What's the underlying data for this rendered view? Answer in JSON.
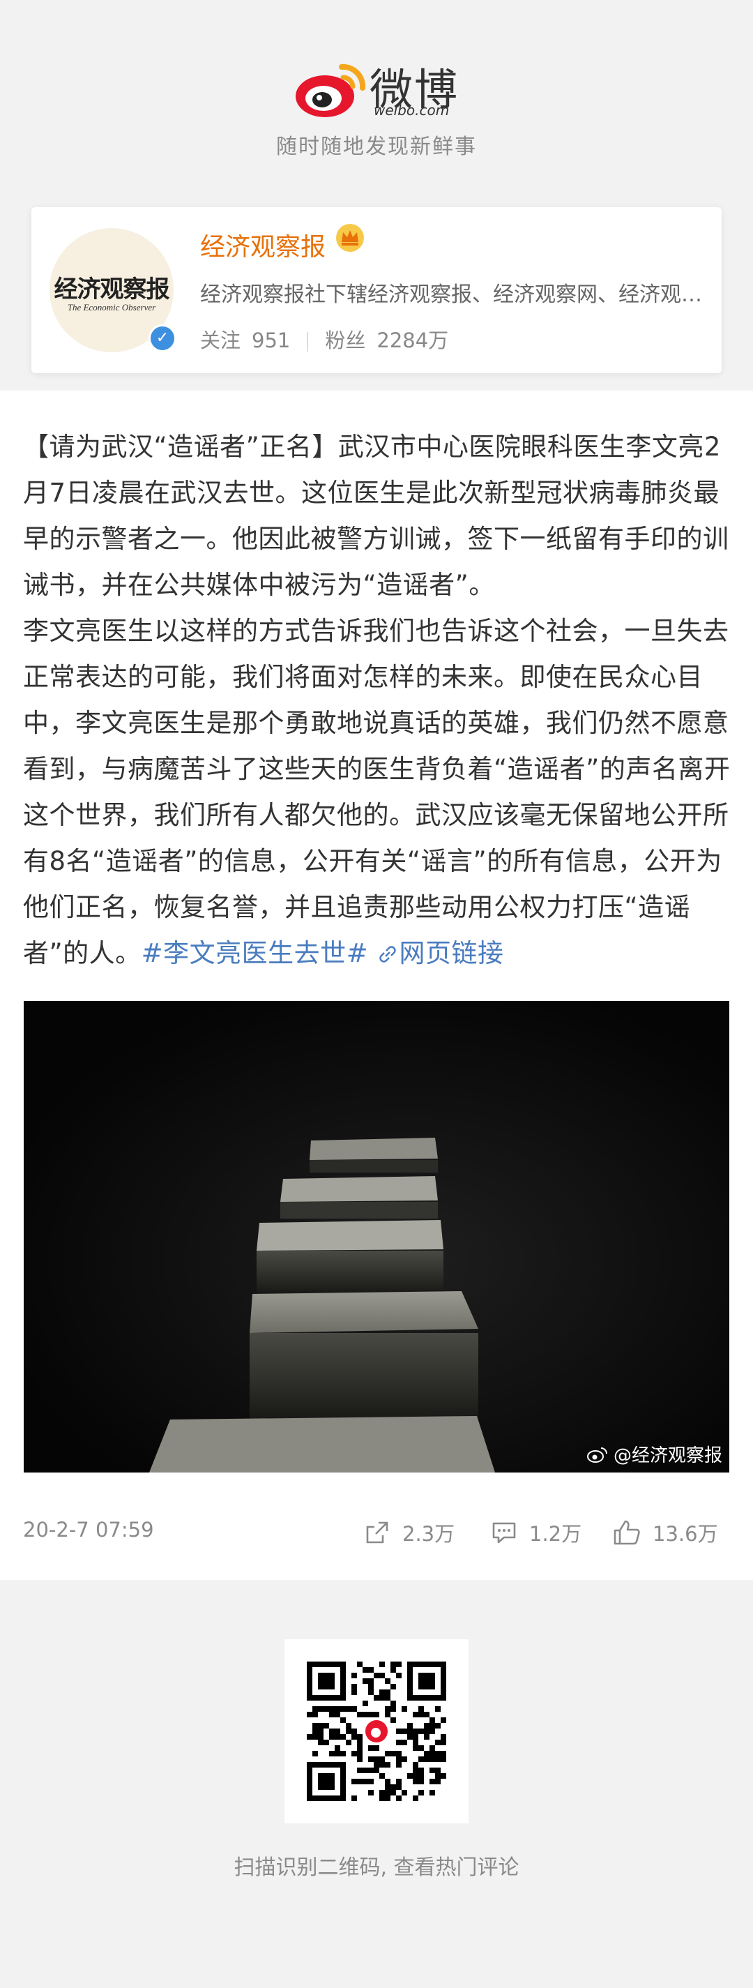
{
  "header": {
    "logo_text": "微博",
    "logo_sub": "weibo.com",
    "tagline": "随时随地发现新鲜事"
  },
  "profile": {
    "avatar_title": "经济观察报",
    "avatar_sub": "The Economic Observer",
    "name": "经济观察报",
    "bio": "经济观察报社下辖经济观察报、经济观察网、经济观察研究院等",
    "follow_label": "关注",
    "follow_count": "951",
    "fans_label": "粉丝",
    "fans_count": "2284万",
    "verified_icon": "verified-badge-icon",
    "member_icon": "crown-icon"
  },
  "post": {
    "text_p1": "【请为武汉“造谣者”正名】武汉市中心医院眼科医生李文亮2月7日凌晨在武汉去世。这位医生是此次新型冠状病毒肺炎最早的示警者之一。他因此被警方训诫，签下一纸留有手印的训诫书，并在公共媒体中被污为“造谣者”。",
    "text_p2": "李文亮医生以这样的方式告诉我们也告诉这个社会，一旦失去正常表达的可能，我们将面对怎样的未来。即使在民众心目中，李文亮医生是那个勇敢地说真话的英雄，我们仍然不愿意看到，与病魔苦斗了这些天的医生背负着“造谣者”的声名离开这个世界，我们所有人都欠他的。武汉应该毫无保留地公开所有8名“造谣者”的信息，公开有关“谣言”的所有信息，公开为他们正名，恢复名誉，并且追责那些动用公权力打压“造谣者”的人。",
    "hashtag": "#李文亮医生去世#",
    "link_label": "网页链接",
    "image_watermark": "@经济观察报",
    "time": "20-2-7 07:59",
    "repost_count": "2.3万",
    "comment_count": "1.2万",
    "like_count": "13.6万"
  },
  "footer": {
    "qr_hint": "扫描识别二维码, 查看热门评论"
  },
  "colors": {
    "accent_orange": "#e8710a",
    "link_blue": "#4a7cbf",
    "weibo_red": "#e6162d"
  }
}
